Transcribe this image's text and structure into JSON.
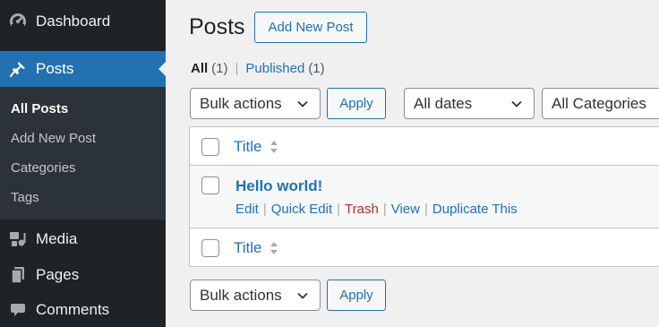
{
  "sidebar": {
    "dashboard": "Dashboard",
    "posts": "Posts",
    "submenu": [
      "All Posts",
      "Add New Post",
      "Categories",
      "Tags"
    ],
    "media": "Media",
    "pages": "Pages",
    "comments": "Comments"
  },
  "page": {
    "title": "Posts",
    "add_new": "Add New Post"
  },
  "views": {
    "all": "All",
    "all_count": "(1)",
    "separator": "|",
    "published": "Published",
    "published_count": "(1)"
  },
  "filters": {
    "bulk_actions": "Bulk actions",
    "apply": "Apply",
    "dates": "All dates",
    "categories": "All Categories"
  },
  "table": {
    "column_title": "Title",
    "post": {
      "title": "Hello world!",
      "actions": [
        "Edit",
        "Quick Edit",
        "Trash",
        "View",
        "Duplicate This"
      ]
    }
  },
  "colors": {
    "sidebar_bg": "#1d2327",
    "submenu_bg": "#2c3338",
    "accent": "#2271b1",
    "trash": "#b32d2e"
  }
}
